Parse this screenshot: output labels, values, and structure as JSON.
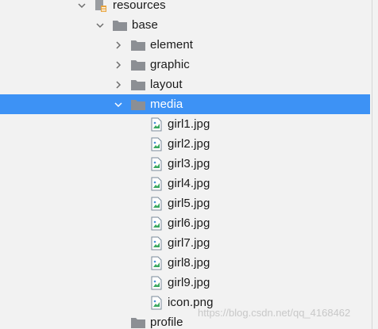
{
  "tree": {
    "resources": {
      "label": "resources",
      "icon": "resource-folder-icon",
      "expanded": true
    },
    "base": {
      "label": "base",
      "icon": "folder-icon",
      "expanded": true
    },
    "children": [
      {
        "label": "element",
        "icon": "folder-icon",
        "expanded": false
      },
      {
        "label": "graphic",
        "icon": "folder-icon",
        "expanded": false
      },
      {
        "label": "layout",
        "icon": "folder-icon",
        "expanded": false
      },
      {
        "label": "media",
        "icon": "folder-icon",
        "expanded": true,
        "selected": true
      }
    ],
    "media_files": [
      {
        "label": "girl1.jpg",
        "icon": "image-file-icon"
      },
      {
        "label": "girl2.jpg",
        "icon": "image-file-icon"
      },
      {
        "label": "girl3.jpg",
        "icon": "image-file-icon"
      },
      {
        "label": "girl4.jpg",
        "icon": "image-file-icon"
      },
      {
        "label": "girl5.jpg",
        "icon": "image-file-icon"
      },
      {
        "label": "girl6.jpg",
        "icon": "image-file-icon"
      },
      {
        "label": "girl7.jpg",
        "icon": "image-file-icon"
      },
      {
        "label": "girl8.jpg",
        "icon": "image-file-icon"
      },
      {
        "label": "girl9.jpg",
        "icon": "image-file-icon"
      },
      {
        "label": "icon.png",
        "icon": "image-file-icon"
      }
    ],
    "profile": {
      "label": "profile",
      "icon": "folder-icon"
    }
  },
  "watermark": "https://blog.csdn.net/qq_4168462",
  "colors": {
    "background": "#f2f2f2",
    "selection": "#3d92f5",
    "folder": "#8c8f94",
    "chevron": "#6e6e6e"
  }
}
